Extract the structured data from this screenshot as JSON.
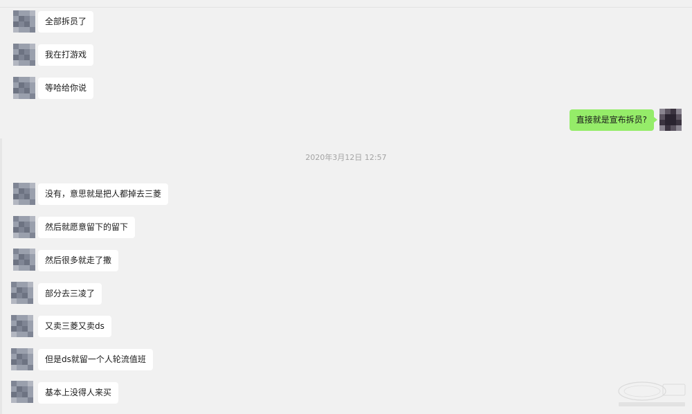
{
  "chat": {
    "timestamp": "2020年3月12日 12:57",
    "messages": [
      {
        "side": "left",
        "text": "全部拆员了"
      },
      {
        "side": "left",
        "text": "我在打游戏"
      },
      {
        "side": "left",
        "text": "等哈给你说"
      },
      {
        "side": "right",
        "text": "直接就是宣布拆员?"
      },
      {
        "side": "left",
        "text": "没有，意思就是把人都掉去三菱"
      },
      {
        "side": "left",
        "text": "然后就愿意留下的留下"
      },
      {
        "side": "left",
        "text": "然后很多就走了撒"
      },
      {
        "side": "left",
        "text": "部分去三凌了"
      },
      {
        "side": "left",
        "text": "又卖三菱又卖ds"
      },
      {
        "side": "left",
        "text": "但是ds就留一个人轮流值班"
      },
      {
        "side": "left",
        "text": "基本上没得人来买"
      }
    ]
  },
  "colors": {
    "background": "#f1f1f1",
    "bubble_received": "#ffffff",
    "bubble_sent": "#95ec69",
    "timestamp_text": "#a3a3a3",
    "avatar_left": [
      "#7f8594",
      "#9aa0ad",
      "#6d7382",
      "#b3b7c1"
    ],
    "avatar_right": [
      "#3b3440",
      "#5b5460",
      "#2a2430",
      "#8a8590"
    ]
  },
  "icons": {
    "avatar_left": "pixelated-avatar-icon",
    "avatar_right": "pixelated-avatar-icon",
    "watermark": "watermark-logo-icon"
  }
}
